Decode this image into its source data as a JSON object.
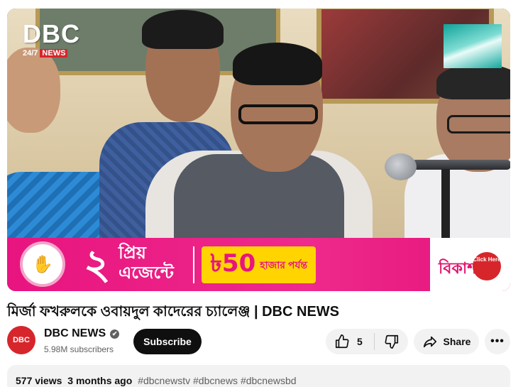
{
  "player": {
    "logo_text": "DBC",
    "logo_sub": "24/7",
    "logo_news": "NEWS"
  },
  "ad": {
    "number": "২",
    "agent_text": "প্রিয় এজেন্টে",
    "amount": "৳50",
    "amount_unit": "হাজার পর্যন্ত",
    "brand": "বিকাশ",
    "click_here": "Click Here"
  },
  "video": {
    "title": "মির্জা ফখরুলকে ওবায়দুল কাদেরের চ্যালেঞ্জ | DBC NEWS"
  },
  "channel": {
    "avatar_text": "DBC",
    "name": "DBC NEWS",
    "verified_mark": "✔",
    "subscribers": "5.98M subscribers",
    "subscribe_label": "Subscribe"
  },
  "actions": {
    "like_count": "5",
    "share_label": "Share",
    "more_label": "•••"
  },
  "description": {
    "views": "577 views",
    "age": "3 months ago",
    "tags": "#dbcnewstv #dbcnews #dbcnewsbd"
  },
  "colors": {
    "brand_red": "#d6262b",
    "ad_pink": "#e8147f",
    "ad_yellow": "#ffd400"
  },
  "icons": [
    "thumbs-up-icon",
    "thumbs-down-icon",
    "share-arrow-icon",
    "more-icon",
    "verified-icon"
  ]
}
